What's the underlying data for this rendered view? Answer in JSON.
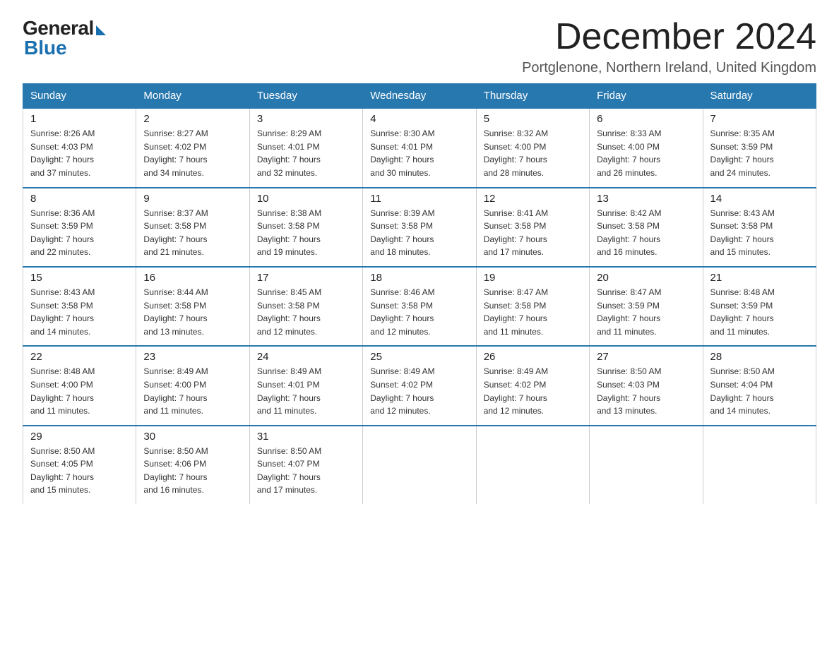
{
  "logo": {
    "general": "General",
    "blue": "Blue"
  },
  "title": "December 2024",
  "location": "Portglenone, Northern Ireland, United Kingdom",
  "weekdays": [
    "Sunday",
    "Monday",
    "Tuesday",
    "Wednesday",
    "Thursday",
    "Friday",
    "Saturday"
  ],
  "weeks": [
    [
      {
        "day": "1",
        "sunrise": "Sunrise: 8:26 AM",
        "sunset": "Sunset: 4:03 PM",
        "daylight": "Daylight: 7 hours",
        "minutes": "and 37 minutes."
      },
      {
        "day": "2",
        "sunrise": "Sunrise: 8:27 AM",
        "sunset": "Sunset: 4:02 PM",
        "daylight": "Daylight: 7 hours",
        "minutes": "and 34 minutes."
      },
      {
        "day": "3",
        "sunrise": "Sunrise: 8:29 AM",
        "sunset": "Sunset: 4:01 PM",
        "daylight": "Daylight: 7 hours",
        "minutes": "and 32 minutes."
      },
      {
        "day": "4",
        "sunrise": "Sunrise: 8:30 AM",
        "sunset": "Sunset: 4:01 PM",
        "daylight": "Daylight: 7 hours",
        "minutes": "and 30 minutes."
      },
      {
        "day": "5",
        "sunrise": "Sunrise: 8:32 AM",
        "sunset": "Sunset: 4:00 PM",
        "daylight": "Daylight: 7 hours",
        "minutes": "and 28 minutes."
      },
      {
        "day": "6",
        "sunrise": "Sunrise: 8:33 AM",
        "sunset": "Sunset: 4:00 PM",
        "daylight": "Daylight: 7 hours",
        "minutes": "and 26 minutes."
      },
      {
        "day": "7",
        "sunrise": "Sunrise: 8:35 AM",
        "sunset": "Sunset: 3:59 PM",
        "daylight": "Daylight: 7 hours",
        "minutes": "and 24 minutes."
      }
    ],
    [
      {
        "day": "8",
        "sunrise": "Sunrise: 8:36 AM",
        "sunset": "Sunset: 3:59 PM",
        "daylight": "Daylight: 7 hours",
        "minutes": "and 22 minutes."
      },
      {
        "day": "9",
        "sunrise": "Sunrise: 8:37 AM",
        "sunset": "Sunset: 3:58 PM",
        "daylight": "Daylight: 7 hours",
        "minutes": "and 21 minutes."
      },
      {
        "day": "10",
        "sunrise": "Sunrise: 8:38 AM",
        "sunset": "Sunset: 3:58 PM",
        "daylight": "Daylight: 7 hours",
        "minutes": "and 19 minutes."
      },
      {
        "day": "11",
        "sunrise": "Sunrise: 8:39 AM",
        "sunset": "Sunset: 3:58 PM",
        "daylight": "Daylight: 7 hours",
        "minutes": "and 18 minutes."
      },
      {
        "day": "12",
        "sunrise": "Sunrise: 8:41 AM",
        "sunset": "Sunset: 3:58 PM",
        "daylight": "Daylight: 7 hours",
        "minutes": "and 17 minutes."
      },
      {
        "day": "13",
        "sunrise": "Sunrise: 8:42 AM",
        "sunset": "Sunset: 3:58 PM",
        "daylight": "Daylight: 7 hours",
        "minutes": "and 16 minutes."
      },
      {
        "day": "14",
        "sunrise": "Sunrise: 8:43 AM",
        "sunset": "Sunset: 3:58 PM",
        "daylight": "Daylight: 7 hours",
        "minutes": "and 15 minutes."
      }
    ],
    [
      {
        "day": "15",
        "sunrise": "Sunrise: 8:43 AM",
        "sunset": "Sunset: 3:58 PM",
        "daylight": "Daylight: 7 hours",
        "minutes": "and 14 minutes."
      },
      {
        "day": "16",
        "sunrise": "Sunrise: 8:44 AM",
        "sunset": "Sunset: 3:58 PM",
        "daylight": "Daylight: 7 hours",
        "minutes": "and 13 minutes."
      },
      {
        "day": "17",
        "sunrise": "Sunrise: 8:45 AM",
        "sunset": "Sunset: 3:58 PM",
        "daylight": "Daylight: 7 hours",
        "minutes": "and 12 minutes."
      },
      {
        "day": "18",
        "sunrise": "Sunrise: 8:46 AM",
        "sunset": "Sunset: 3:58 PM",
        "daylight": "Daylight: 7 hours",
        "minutes": "and 12 minutes."
      },
      {
        "day": "19",
        "sunrise": "Sunrise: 8:47 AM",
        "sunset": "Sunset: 3:58 PM",
        "daylight": "Daylight: 7 hours",
        "minutes": "and 11 minutes."
      },
      {
        "day": "20",
        "sunrise": "Sunrise: 8:47 AM",
        "sunset": "Sunset: 3:59 PM",
        "daylight": "Daylight: 7 hours",
        "minutes": "and 11 minutes."
      },
      {
        "day": "21",
        "sunrise": "Sunrise: 8:48 AM",
        "sunset": "Sunset: 3:59 PM",
        "daylight": "Daylight: 7 hours",
        "minutes": "and 11 minutes."
      }
    ],
    [
      {
        "day": "22",
        "sunrise": "Sunrise: 8:48 AM",
        "sunset": "Sunset: 4:00 PM",
        "daylight": "Daylight: 7 hours",
        "minutes": "and 11 minutes."
      },
      {
        "day": "23",
        "sunrise": "Sunrise: 8:49 AM",
        "sunset": "Sunset: 4:00 PM",
        "daylight": "Daylight: 7 hours",
        "minutes": "and 11 minutes."
      },
      {
        "day": "24",
        "sunrise": "Sunrise: 8:49 AM",
        "sunset": "Sunset: 4:01 PM",
        "daylight": "Daylight: 7 hours",
        "minutes": "and 11 minutes."
      },
      {
        "day": "25",
        "sunrise": "Sunrise: 8:49 AM",
        "sunset": "Sunset: 4:02 PM",
        "daylight": "Daylight: 7 hours",
        "minutes": "and 12 minutes."
      },
      {
        "day": "26",
        "sunrise": "Sunrise: 8:49 AM",
        "sunset": "Sunset: 4:02 PM",
        "daylight": "Daylight: 7 hours",
        "minutes": "and 12 minutes."
      },
      {
        "day": "27",
        "sunrise": "Sunrise: 8:50 AM",
        "sunset": "Sunset: 4:03 PM",
        "daylight": "Daylight: 7 hours",
        "minutes": "and 13 minutes."
      },
      {
        "day": "28",
        "sunrise": "Sunrise: 8:50 AM",
        "sunset": "Sunset: 4:04 PM",
        "daylight": "Daylight: 7 hours",
        "minutes": "and 14 minutes."
      }
    ],
    [
      {
        "day": "29",
        "sunrise": "Sunrise: 8:50 AM",
        "sunset": "Sunset: 4:05 PM",
        "daylight": "Daylight: 7 hours",
        "minutes": "and 15 minutes."
      },
      {
        "day": "30",
        "sunrise": "Sunrise: 8:50 AM",
        "sunset": "Sunset: 4:06 PM",
        "daylight": "Daylight: 7 hours",
        "minutes": "and 16 minutes."
      },
      {
        "day": "31",
        "sunrise": "Sunrise: 8:50 AM",
        "sunset": "Sunset: 4:07 PM",
        "daylight": "Daylight: 7 hours",
        "minutes": "and 17 minutes."
      },
      null,
      null,
      null,
      null
    ]
  ]
}
